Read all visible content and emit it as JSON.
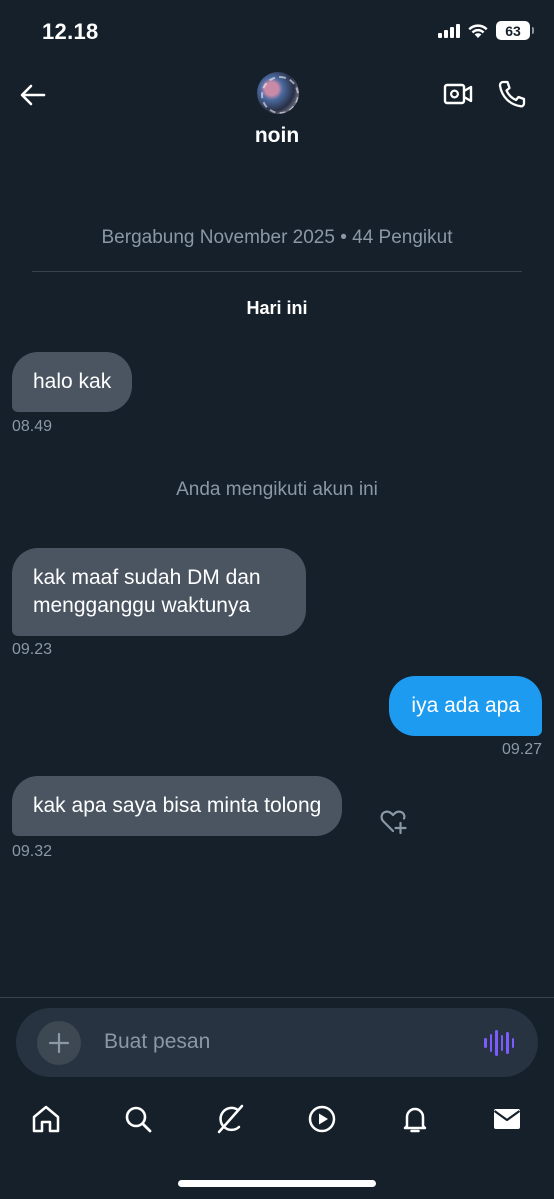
{
  "status_bar": {
    "time": "12.18",
    "battery": "63"
  },
  "header": {
    "contact_name": "noin"
  },
  "profile_info": "Bergabung November 2025 • 44 Pengikut",
  "date_label": "Hari ini",
  "messages": [
    {
      "direction": "incoming",
      "text": "halo kak",
      "time": "08.49"
    },
    {
      "direction": "incoming",
      "text": "kak maaf sudah DM dan mengganggu waktunya",
      "time": "09.23"
    },
    {
      "direction": "outgoing",
      "text": "iya ada apa",
      "time": "09.27"
    },
    {
      "direction": "incoming",
      "text": "kak apa saya bisa minta tolong",
      "time": "09.32"
    }
  ],
  "system_note": "Anda mengikuti akun ini",
  "composer": {
    "placeholder": "Buat pesan"
  },
  "bottom_nav": [
    "home-icon",
    "search-icon",
    "grok-icon",
    "video-play-icon",
    "bell-icon",
    "mail-icon"
  ],
  "colors": {
    "background": "#15202b",
    "incoming_bubble": "#4b5561",
    "outgoing_bubble": "#1d9bf0",
    "voice_accent": "#7c5cff",
    "muted_text": "#8b98a5"
  }
}
